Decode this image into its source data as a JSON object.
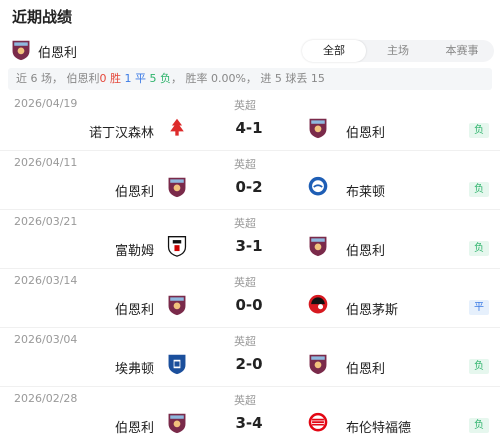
{
  "header": {
    "title": "近期战绩"
  },
  "team": {
    "name": "伯恩利"
  },
  "tabs": [
    {
      "label": "全部",
      "active": true
    },
    {
      "label": "主场",
      "active": false
    },
    {
      "label": "本赛事",
      "active": false
    }
  ],
  "summary": {
    "prefix": "近 6 场， 伯恩利",
    "wins": "0 胜",
    "draws": "1 平",
    "losses": "5 负",
    "suffix": "， 胜率 0.00%， 进 5 球丢 15"
  },
  "matches": [
    {
      "date": "2026/04/19",
      "league": "英超",
      "home": "诺丁汉森林",
      "score": "4-1",
      "away": "伯恩利",
      "result": "负"
    },
    {
      "date": "2026/04/11",
      "league": "英超",
      "home": "伯恩利",
      "score": "0-2",
      "away": "布莱顿",
      "result": "负"
    },
    {
      "date": "2026/03/21",
      "league": "英超",
      "home": "富勒姆",
      "score": "3-1",
      "away": "伯恩利",
      "result": "负"
    },
    {
      "date": "2026/03/14",
      "league": "英超",
      "home": "伯恩利",
      "score": "0-0",
      "away": "伯恩茅斯",
      "result": "平"
    },
    {
      "date": "2026/03/04",
      "league": "英超",
      "home": "埃弗顿",
      "score": "2-0",
      "away": "伯恩利",
      "result": "负"
    },
    {
      "date": "2026/02/28",
      "league": "英超",
      "home": "伯恩利",
      "score": "3-4",
      "away": "布伦特福德",
      "result": "负"
    }
  ],
  "colors": {
    "burnley": "#7a2a4a",
    "loss": "#2db36b",
    "draw": "#3b7be5",
    "win": "#e5483b"
  }
}
